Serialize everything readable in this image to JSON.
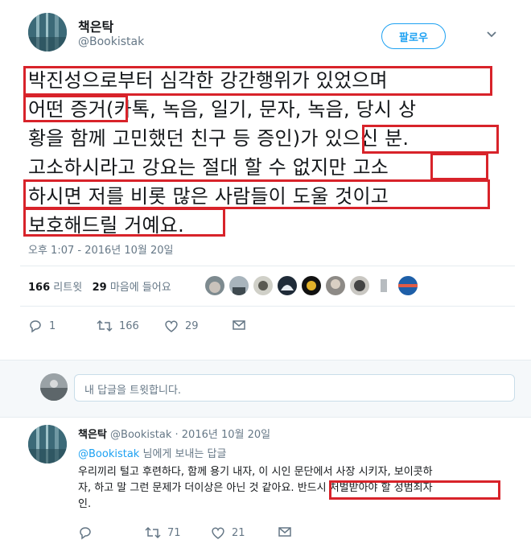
{
  "tweet": {
    "author_name": "책은탁",
    "author_handle": "@Bookistak",
    "follow_label": "팔로우",
    "lines": [
      "박진성으로부터 심각한 강간행위가 있었으며",
      "어떤 증거(카톡, 녹음, 일기, 문자, 녹음, 당시 상",
      "황을 함께 고민했던 친구 등 증인)가 있으신 분.",
      "고소하시라고 강요는 절대 할 수 없지만 고소",
      "하시면 저를 비롯 많은 사람들이 도울 것이고",
      "보호해드릴 거예요."
    ],
    "timestamp": "오후 1:07 - 2016년 10월 20일",
    "retweets_count": "166",
    "retweets_label": "리트윗",
    "likes_count": "29",
    "likes_label": "마음에 들어요",
    "actions": {
      "reply": "1",
      "retweet": "166",
      "like": "29"
    }
  },
  "reply_box": {
    "placeholder": "내 답글을 트윗합니다."
  },
  "reply_tweet": {
    "author_name": "책은탁",
    "author_handle": "@Bookistak",
    "date": "· 2016년 10월 20일",
    "to_handle": "@Bookistak",
    "to_suffix": "님에게 보내는 답글",
    "body_lines": [
      "우리끼리 털고 후련하다, 함께 용기 내자, 이 시인 문단에서 사장 시키자, 보이콧하",
      "자, 하고 말 그런 문제가 더이상은 아닌 것 같아요. 반드시 처벌받아야 할 성범죄자",
      "인."
    ],
    "actions": {
      "reply": "",
      "retweet": "71",
      "like": "21"
    }
  },
  "colors": {
    "accent": "#1da1f2",
    "highlight": "#d8232a",
    "muted": "#657786"
  }
}
